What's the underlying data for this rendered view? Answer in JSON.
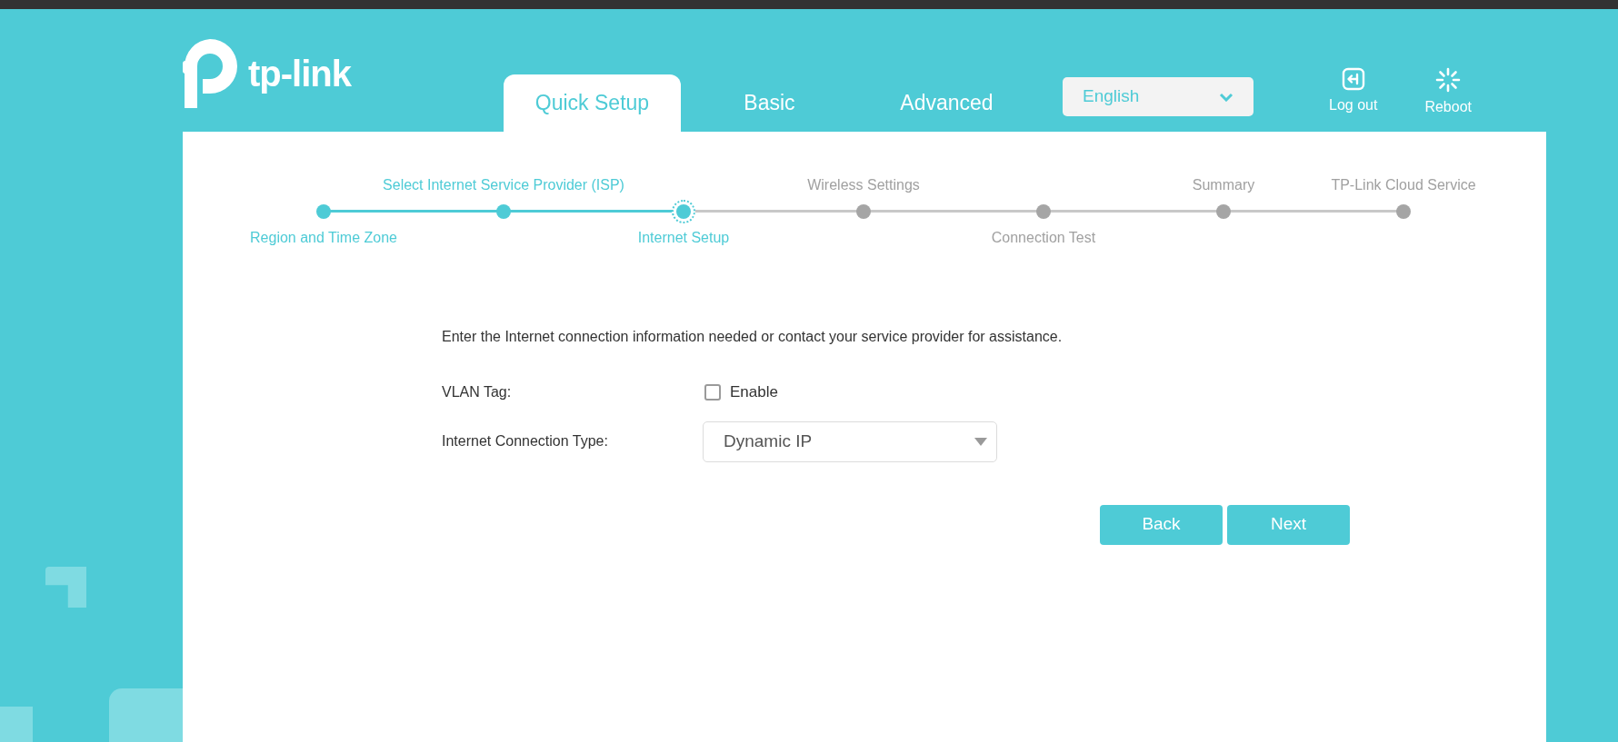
{
  "logo": {
    "text": "tp-link"
  },
  "tabs": [
    {
      "label": "Quick Setup",
      "selected": true
    },
    {
      "label": "Basic",
      "selected": false
    },
    {
      "label": "Advanced",
      "selected": false
    }
  ],
  "language": {
    "value": "English"
  },
  "header_actions": [
    {
      "label": "Log out",
      "kind": "logout"
    },
    {
      "label": "Reboot",
      "kind": "reboot"
    }
  ],
  "steps": [
    {
      "label": "Region and Time Zone",
      "label_above": false,
      "completed": true,
      "current": false
    },
    {
      "label": "Select Internet Service Provider (ISP)",
      "label_above": true,
      "completed": true,
      "current": false
    },
    {
      "label": "Internet Setup",
      "label_above": false,
      "completed": false,
      "current": true
    },
    {
      "label": "Wireless Settings",
      "label_above": true,
      "completed": false,
      "current": false
    },
    {
      "label": "Connection Test",
      "label_above": false,
      "completed": false,
      "current": false
    },
    {
      "label": "Summary",
      "label_above": true,
      "completed": false,
      "current": false
    },
    {
      "label": "TP-Link Cloud Service",
      "label_above": true,
      "completed": false,
      "current": false
    }
  ],
  "form": {
    "intro": "Enter the Internet connection information needed or contact your service provider for assistance.",
    "vlan": {
      "label": "VLAN Tag:",
      "option": "Enable",
      "checked": false
    },
    "connection_type": {
      "label": "Internet Connection Type:",
      "value": "Dynamic IP"
    }
  },
  "buttons": [
    {
      "label": "Back"
    },
    {
      "label": "Next"
    }
  ]
}
